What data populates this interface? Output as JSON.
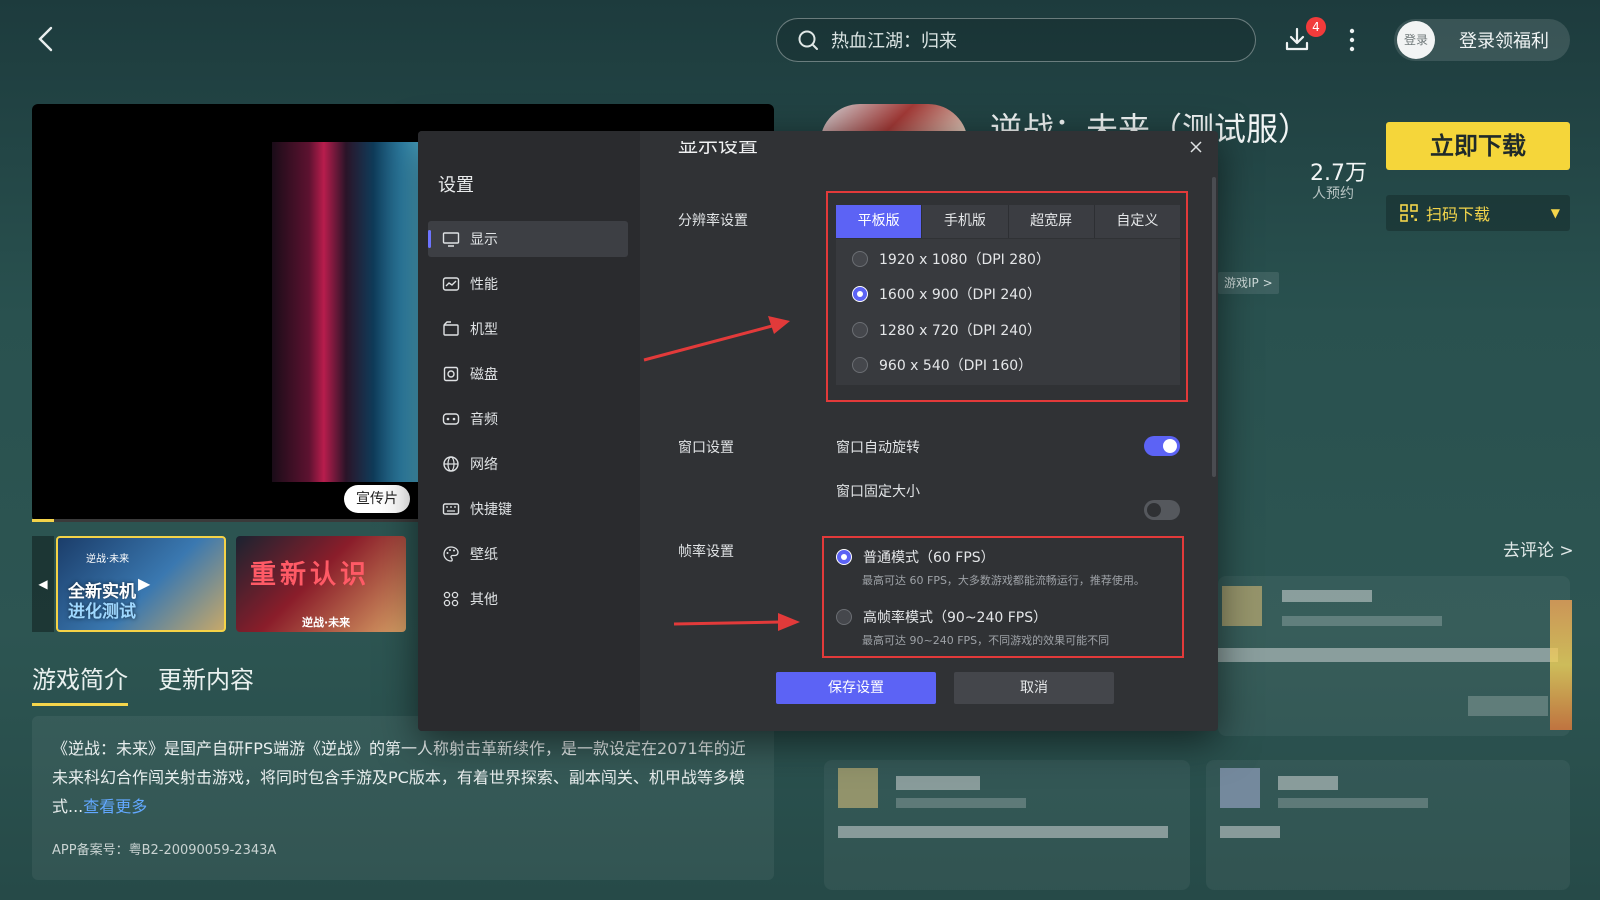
{
  "header": {
    "search_placeholder": "热血江湖：归来",
    "download_badge": "4",
    "avatar_label": "登录",
    "login_label": "登录领福利"
  },
  "media": {
    "video_tag": "宣传片",
    "progress": 0.03,
    "thumbs": [
      {
        "logo": "逆战·未来",
        "text_line1": "全新实机",
        "text_line2": "进化测试"
      },
      {
        "text": "重新认识",
        "logo": "逆战·未来"
      }
    ]
  },
  "tabs": [
    {
      "label": "游戏简介",
      "active": true
    },
    {
      "label": "更新内容",
      "active": false
    }
  ],
  "intro": {
    "text": "《逆战：未来》是国产自研FPS端游《逆战》的第一人称射击革新续作，是一款设定在2071年的近未来科幻合作闯关射击游戏，将同时包含手游及PC版本，有着世界探索、副本闯关、机甲战等多模式...",
    "see_more": "查看更多",
    "icp": "APP备案号：粤B2-20090059-2343A"
  },
  "game": {
    "title": "逆战：未来（测试服）",
    "reserve_count": "2.7万",
    "reserve_label": "人预约",
    "download_label": "立即下载",
    "scan_label": "扫码下载",
    "ip_tag": "游戏IP >",
    "comment_link": "去评论 >"
  },
  "modal": {
    "title": "设置",
    "section_heading": "显示设置",
    "menu": [
      {
        "label": "显示",
        "icon": "monitor-icon",
        "active": true
      },
      {
        "label": "性能",
        "icon": "performance-icon",
        "active": false
      },
      {
        "label": "机型",
        "icon": "device-icon",
        "active": false
      },
      {
        "label": "磁盘",
        "icon": "disk-icon",
        "active": false
      },
      {
        "label": "音频",
        "icon": "audio-icon",
        "active": false
      },
      {
        "label": "网络",
        "icon": "globe-icon",
        "active": false
      },
      {
        "label": "快捷键",
        "icon": "keyboard-icon",
        "active": false
      },
      {
        "label": "壁纸",
        "icon": "palette-icon",
        "active": false
      },
      {
        "label": "其他",
        "icon": "grid-icon",
        "active": false
      }
    ],
    "resolution": {
      "label": "分辨率设置",
      "tabs": [
        {
          "label": "平板版",
          "active": true
        },
        {
          "label": "手机版",
          "active": false
        },
        {
          "label": "超宽屏",
          "active": false
        },
        {
          "label": "自定义",
          "active": false
        }
      ],
      "options": [
        {
          "label": "1920 x 1080（DPI 280）",
          "selected": false
        },
        {
          "label": "1600 x 900（DPI 240）",
          "selected": true
        },
        {
          "label": "1280 x 720（DPI 240）",
          "selected": false
        },
        {
          "label": "960 x 540（DPI 160）",
          "selected": false
        }
      ]
    },
    "window": {
      "label": "窗口设置",
      "auto_rotate_label": "窗口自动旋转",
      "auto_rotate_on": true,
      "fixed_size_label": "窗口固定大小",
      "fixed_size_on": false
    },
    "fps": {
      "label": "帧率设置",
      "options": [
        {
          "label": "普通模式（60 FPS）",
          "desc": "最高可达 60 FPS，大多数游戏都能流畅运行，推荐使用。",
          "selected": true
        },
        {
          "label": "高帧率模式（90~240 FPS）",
          "desc": "最高可达 90~240 FPS，不同游戏的效果可能不同",
          "selected": false
        }
      ]
    },
    "save_label": "保存设置",
    "cancel_label": "取消"
  },
  "colors": {
    "accent": "#5c63f5",
    "highlight_box": "#e23a3a",
    "download_yellow": "#f5d63a"
  }
}
